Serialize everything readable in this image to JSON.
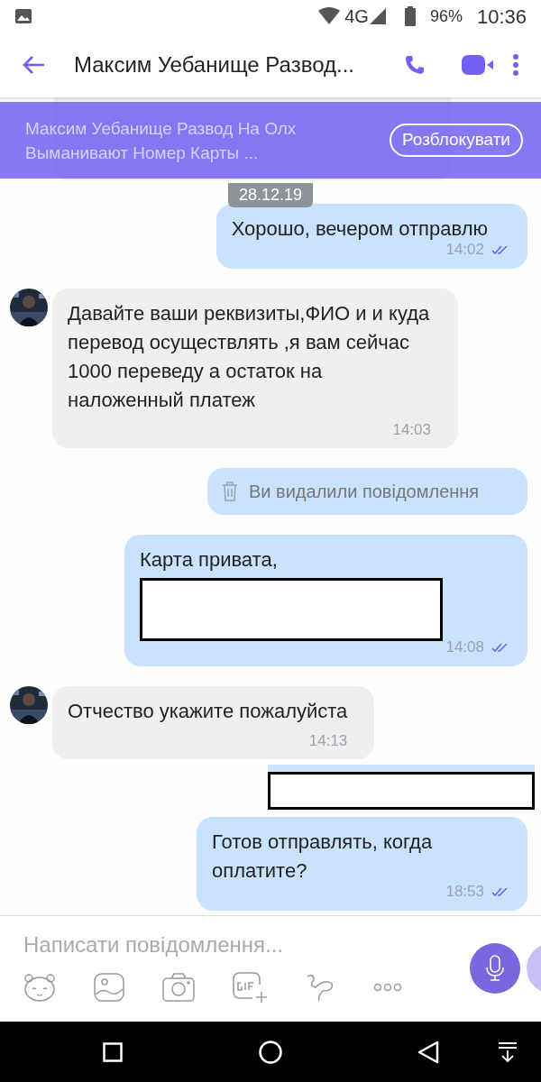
{
  "status_bar": {
    "network": "4G",
    "battery": "96%",
    "time": "10:36"
  },
  "header": {
    "title": "Максим Уебанище Развод..."
  },
  "blocked_banner": {
    "text": "Максим Уебанище Развод На Олх Выманивают Номер Карты ...",
    "button": "Розблокувати"
  },
  "messages": [
    {
      "kind": "date",
      "text": "28.12.19"
    },
    {
      "kind": "outgoing",
      "text": "Хорошо, вечером отправлю",
      "time": "14:02",
      "read": true
    },
    {
      "kind": "incoming",
      "text": "Давайте ваши реквизиты,ФИО и и куда перевод осуществлять ,я вам сейчас 1000 переведу а остаток на наложенный платеж",
      "time": "14:03"
    },
    {
      "kind": "deleted",
      "text": "Ви видалили повідомлення"
    },
    {
      "kind": "outgoing",
      "text": "Карта привата,",
      "redacted": true,
      "time": "14:08",
      "read": true
    },
    {
      "kind": "incoming",
      "text": "Отчество укажите пожалуйста",
      "time": "14:13"
    },
    {
      "kind": "hidden"
    },
    {
      "kind": "outgoing",
      "text": "Готов отправлять, когда оплатите?",
      "time": "18:53",
      "read": true
    }
  ],
  "composer": {
    "placeholder": "Написати повідомлення..."
  }
}
